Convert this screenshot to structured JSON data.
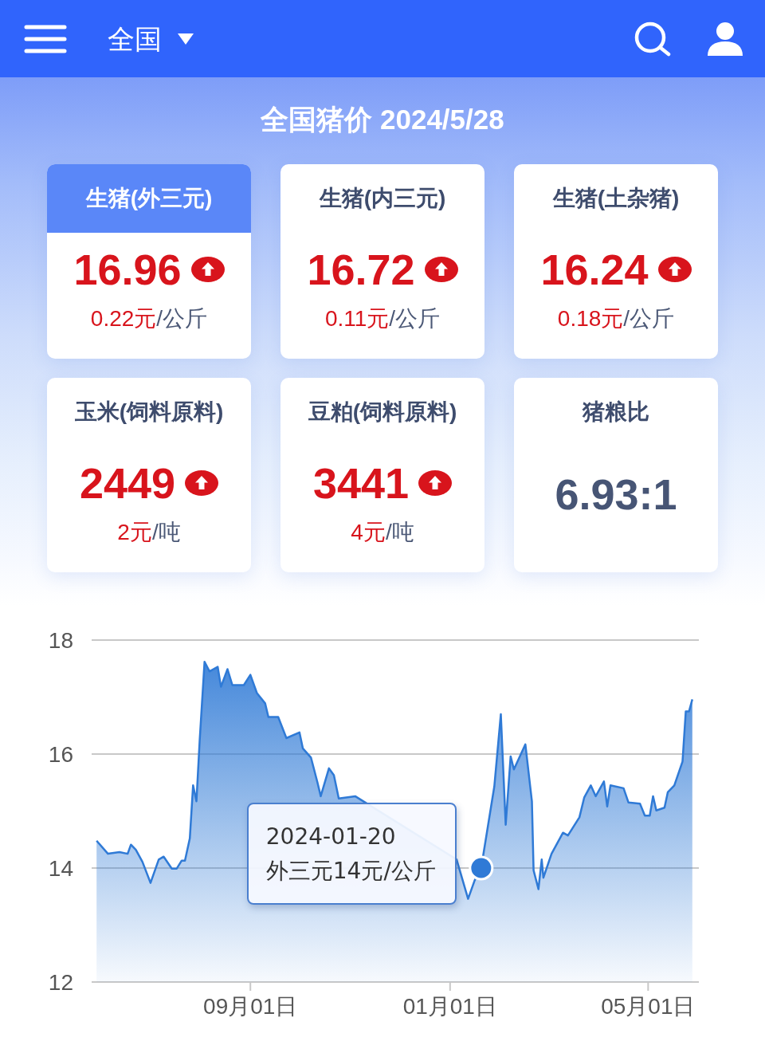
{
  "header": {
    "region": "全国"
  },
  "title": "全国猪价 2024/5/28",
  "cards": [
    {
      "kind": "price",
      "title": "生猪(外三元)",
      "selected": true,
      "value": "16.96",
      "rising": true,
      "change": "0.22元",
      "unit": "/公斤"
    },
    {
      "kind": "price",
      "title": "生猪(内三元)",
      "selected": false,
      "value": "16.72",
      "rising": true,
      "change": "0.11元",
      "unit": "/公斤"
    },
    {
      "kind": "price",
      "title": "生猪(土杂猪)",
      "selected": false,
      "value": "16.24",
      "rising": true,
      "change": "0.18元",
      "unit": "/公斤"
    },
    {
      "kind": "price",
      "title": "玉米(饲料原料)",
      "selected": false,
      "value": "2449",
      "rising": true,
      "change": "2元",
      "unit": "/吨"
    },
    {
      "kind": "price",
      "title": "豆粕(饲料原料)",
      "selected": false,
      "value": "3441",
      "rising": true,
      "change": "4元",
      "unit": "/吨"
    },
    {
      "kind": "ratio",
      "title": "猪粮比",
      "selected": false,
      "value": "6.93:1"
    }
  ],
  "chart": {
    "tooltip": {
      "date": "2024-01-20"
    },
    "chart_data": {
      "type": "area",
      "x": [
        "2023-05-30",
        "2023-06-06",
        "2023-06-13",
        "2023-06-18",
        "2023-06-20",
        "2023-06-23",
        "2023-06-27",
        "2023-07-02",
        "2023-07-07",
        "2023-07-10",
        "2023-07-15",
        "2023-07-18",
        "2023-07-21",
        "2023-07-23",
        "2023-07-26",
        "2023-07-28",
        "2023-07-30",
        "2023-08-01",
        "2023-08-04",
        "2023-08-07",
        "2023-08-12",
        "2023-08-14",
        "2023-08-18",
        "2023-08-21",
        "2023-08-28",
        "2023-09-01",
        "2023-09-05",
        "2023-09-10",
        "2023-09-12",
        "2023-09-18",
        "2023-09-23",
        "2023-10-01",
        "2023-10-03",
        "2023-10-08",
        "2023-10-12",
        "2023-10-14",
        "2023-10-19",
        "2023-10-22",
        "2023-10-25",
        "2023-11-04",
        "2024-01-05",
        "2024-01-12",
        "2024-01-16",
        "2024-01-20",
        "2024-01-24",
        "2024-01-28",
        "2024-02-01",
        "2024-02-04",
        "2024-02-07",
        "2024-02-09",
        "2024-02-16",
        "2024-02-20",
        "2024-02-21",
        "2024-02-24",
        "2024-02-26",
        "2024-02-27",
        "2024-03-03",
        "2024-03-10",
        "2024-03-13",
        "2024-03-20",
        "2024-03-23",
        "2024-03-27",
        "2024-03-30",
        "2024-04-04",
        "2024-04-06",
        "2024-04-08",
        "2024-04-16",
        "2024-04-19",
        "2024-04-26",
        "2024-04-29",
        "2024-05-02",
        "2024-05-04",
        "2024-05-06",
        "2024-05-11",
        "2024-05-13",
        "2024-05-17",
        "2024-05-22",
        "2024-05-24",
        "2024-05-26",
        "2024-05-28"
      ],
      "series": [
        {
          "color": "#2f7ad6",
          "values": [
            14.48,
            14.25,
            14.28,
            14.25,
            14.41,
            14.32,
            14.11,
            13.74,
            14.15,
            14.2,
            13.99,
            13.99,
            14.13,
            14.13,
            14.52,
            15.45,
            15.17,
            16.24,
            17.62,
            17.45,
            17.53,
            17.18,
            17.49,
            17.21,
            17.21,
            17.39,
            17.07,
            16.89,
            16.65,
            16.65,
            16.28,
            16.38,
            16.1,
            15.94,
            15.5,
            15.26,
            15.75,
            15.63,
            15.22,
            15.26,
            14.15,
            13.46,
            13.78,
            14.0,
            14.71,
            15.43,
            16.7,
            14.76,
            15.96,
            15.73,
            16.17,
            15.17,
            13.96,
            13.63,
            14.15,
            13.83,
            14.25,
            14.62,
            14.57,
            14.89,
            15.24,
            15.45,
            15.26,
            15.52,
            15.08,
            15.45,
            15.4,
            15.15,
            15.13,
            14.92,
            14.92,
            15.26,
            15.01,
            15.06,
            15.33,
            15.45,
            15.87,
            16.75,
            16.75,
            16.96
          ]
        }
      ],
      "xlim": [
        "2023-05-27",
        "2024-06-01"
      ],
      "ylim": [
        12,
        18
      ],
      "yticks": [
        12,
        14,
        16,
        18
      ],
      "xticks": [
        {
          "value": "2023-09-01",
          "label": "09月01日"
        },
        {
          "value": "2024-01-01",
          "label": "01月01日"
        },
        {
          "value": "2024-05-01",
          "label": "05月01日"
        }
      ],
      "annotations": [
        {
          "x": "2024-01-20",
          "y": 14,
          "text": "外三元14元/公斤"
        }
      ]
    }
  }
}
